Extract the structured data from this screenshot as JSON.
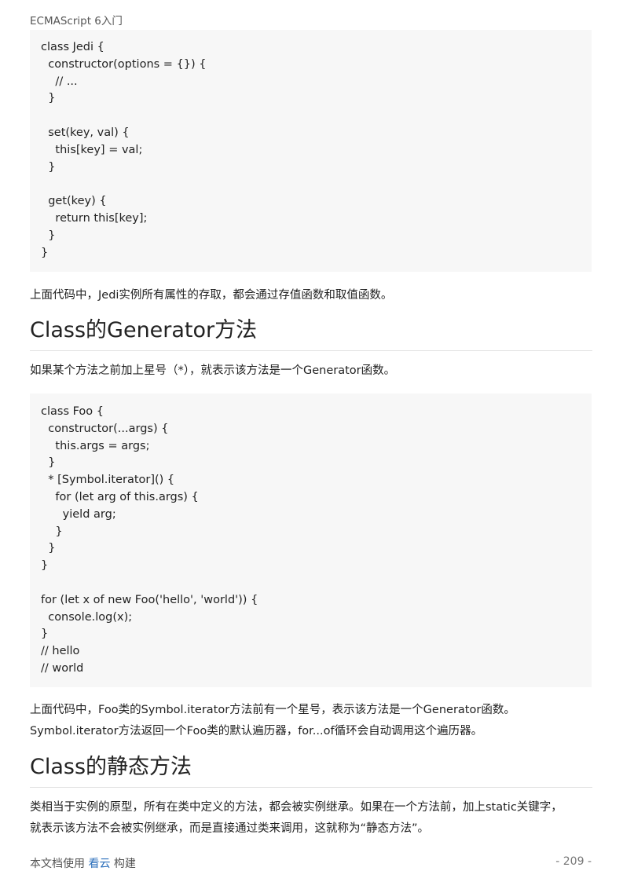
{
  "header": {
    "title": "ECMAScript 6入门"
  },
  "code1": [
    "class Jedi {",
    "  constructor(options = {}) {",
    "    // ...",
    "  }",
    "",
    "  set(key, val) {",
    "    this[key] = val;",
    "  }",
    "",
    "  get(key) {",
    "    return this[key];",
    "  }",
    "}"
  ],
  "para1": "上面代码中，Jedi实例所有属性的存取，都会通过存值函数和取值函数。",
  "heading1": "Class的Generator方法",
  "para2": "如果某个方法之前加上星号（*），就表示该方法是一个Generator函数。",
  "code2": [
    "class Foo {",
    "  constructor(...args) {",
    "    this.args = args;",
    "  }",
    "  * [Symbol.iterator]() {",
    "    for (let arg of this.args) {",
    "      yield arg;",
    "    }",
    "  }",
    "}",
    "",
    "for (let x of new Foo('hello', 'world')) {",
    "  console.log(x);",
    "}",
    "// hello",
    "// world"
  ],
  "para3_line1": "上面代码中，Foo类的Symbol.iterator方法前有一个星号，表示该方法是一个Generator函数。",
  "para3_line2": "Symbol.iterator方法返回一个Foo类的默认遍历器，for...of循环会自动调用这个遍历器。",
  "heading2": "Class的静态方法",
  "para4_line1": "类相当于实例的原型，所有在类中定义的方法，都会被实例继承。如果在一个方法前，加上static关键字，",
  "para4_line2": "就表示该方法不会被实例继承，而是直接通过类来调用，这就称为“静态方法”。",
  "footer": {
    "prefix": "本文档使用 ",
    "link": "看云",
    "suffix": " 构建",
    "page": "- 209 -"
  }
}
